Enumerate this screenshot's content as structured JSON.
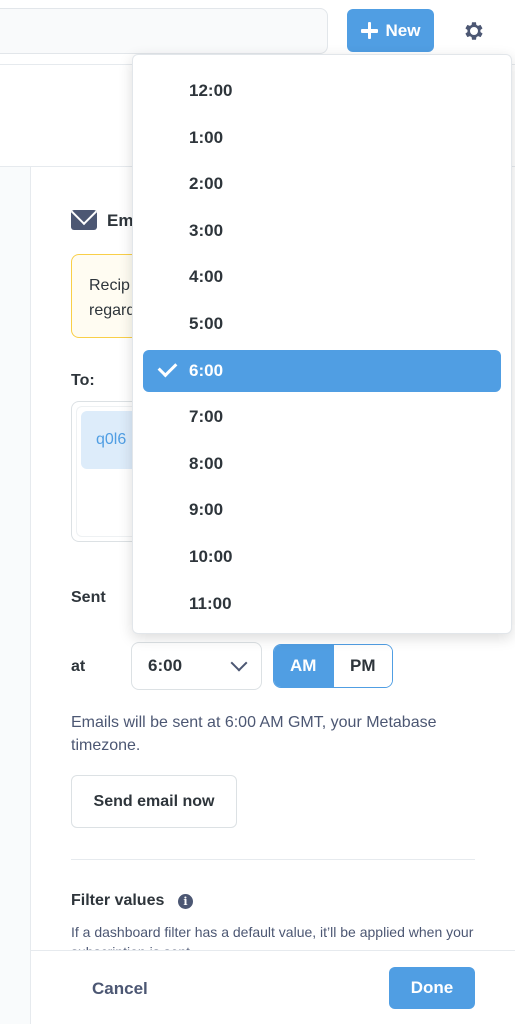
{
  "topbar": {
    "new_button_label": "New",
    "icons": {
      "new": "plus-icon",
      "settings": "gear-icon"
    }
  },
  "subscription": {
    "channel_label": "Em",
    "warning_text_line1": "Recip",
    "warning_text_line2": "regard",
    "to_label": "To:",
    "recipient_chip": "q0l6",
    "sent_label": "Sent",
    "at_label": "at",
    "time_value": "6:00",
    "am_label": "AM",
    "pm_label": "PM",
    "selected_period": "AM",
    "timezone_note": "Emails will be sent at 6:00 AM GMT, your Metabase timezone.",
    "send_now_label": "Send email now",
    "filter_values_title": "Filter values",
    "filter_values_desc": "If a dashboard filter has a default value, it’ll be applied when your subscription is sent."
  },
  "footer": {
    "cancel_label": "Cancel",
    "done_label": "Done"
  },
  "time_dropdown": {
    "options": [
      "12:00",
      "1:00",
      "2:00",
      "3:00",
      "4:00",
      "5:00",
      "6:00",
      "7:00",
      "8:00",
      "9:00",
      "10:00",
      "11:00"
    ],
    "selected": "6:00"
  },
  "colors": {
    "brand": "#509ee3",
    "text_dark": "#2e353b",
    "text_medium": "#4c5773",
    "warning_border": "#f9cf48"
  }
}
